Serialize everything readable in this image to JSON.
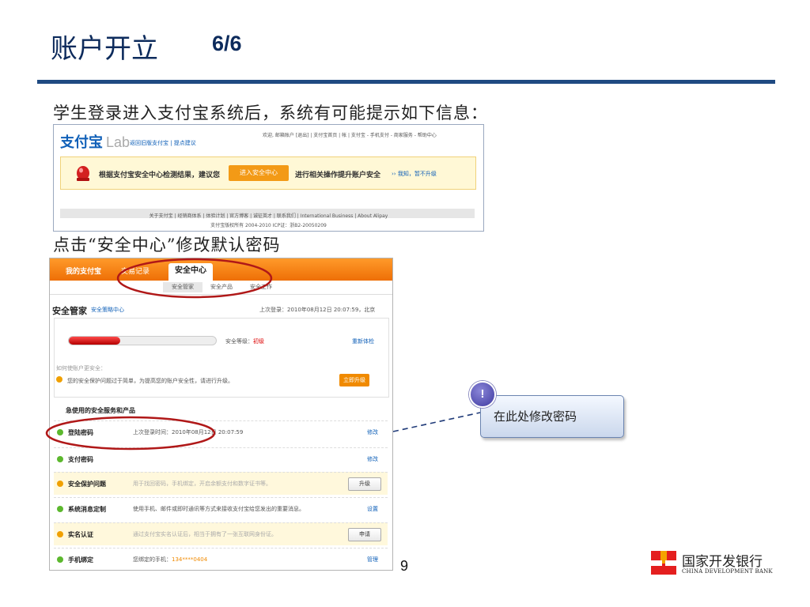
{
  "slide": {
    "title": "账户开立",
    "title_number": "6/6",
    "caption1": "学生登录进入支付宝系统后，系统有可能提示如下信息：",
    "caption2": "点击“安全中心”修改默认密码",
    "page_number": "9"
  },
  "screenshot1": {
    "logo_text": "支付宝",
    "logo_suffix": "Lab",
    "top_left_links": "返回旧版支付宝 | 提点建议",
    "top_right_text": "欢迎, 邮箱账户 [退出] | 支付宝首页 | 帐 | 支付宝 - 手机支付 - 商家服务 - 帮助中心",
    "notice_text": "根据支付宝安全中心检测结果，建议您",
    "notice_button": "进入安全中心",
    "notice_text2": "进行相关操作提升账户安全",
    "notice_skip": "›› 我知，暂不升级",
    "footer_links": "关于支付宝 | 经销商体系 | 体验计划 | 官方博客 | 诚征英才 | 联系我们 | International Business | About Alipay",
    "footer_copyright": "支付宝版权所有 2004-2010 ICP证：浙B2-20050209"
  },
  "screenshot2": {
    "nav_tabs": [
      "我的支付宝",
      "交易记录",
      "安全中心"
    ],
    "sub_tabs": [
      "安全管家",
      "安全产品",
      "安全工作"
    ],
    "heading": "安全管家",
    "heading_link": "安全策略中心",
    "last_login": "上次登录：2010年08月12日 20:07:59，北京",
    "level_label": "安全等级：",
    "level_value": "初级",
    "level_progress": 0.35,
    "recheck": "重新体检",
    "hint": "如何使账户更安全：",
    "warning": "您的安全保护问题过于简单，为提高您的账户安全性，请进行升级。",
    "upgrade_now": "立即升级",
    "section_title": "急使用的安全服务和产品",
    "rows": [
      {
        "name": "登陆密码",
        "desc": "上次登录时间：2010年08月12日 20:07:59",
        "action": "修改",
        "status": "green",
        "yellow": false
      },
      {
        "name": "支付密码",
        "desc": "",
        "action": "修改",
        "status": "green",
        "yellow": false
      },
      {
        "name": "安全保护问题",
        "desc": "用于找回密码，手机绑定，开启余额支付和数字证书等。",
        "action": "升级",
        "status": "orange",
        "yellow": true
      },
      {
        "name": "系统消息定制",
        "desc": "使用手机、邮件或即时通讯等方式来接收支付宝给您发出的重要消息。",
        "action": "设置",
        "status": "green",
        "yellow": false
      },
      {
        "name": "实名认证",
        "desc": "通过支付宝实名认证后，相当于拥有了一张互联网身份证。",
        "action": "申请",
        "status": "orange",
        "yellow": true
      },
      {
        "name": "手机绑定",
        "desc": "您绑定的手机：",
        "desc_highlight": "134****0404",
        "action": "管理",
        "status": "green",
        "yellow": false
      }
    ]
  },
  "callout": {
    "badge": "!",
    "text": "在此处修改密码"
  },
  "bank": {
    "name_cn": "国家开发银行",
    "name_en": "CHINA DEVELOPMENT BANK"
  },
  "colors": {
    "title": "#0d2b5c",
    "rule": "#1f4a82",
    "alipay_orange": "#ee6f06",
    "annotation_red": "#b01818",
    "callout_border": "#6b84b0"
  }
}
